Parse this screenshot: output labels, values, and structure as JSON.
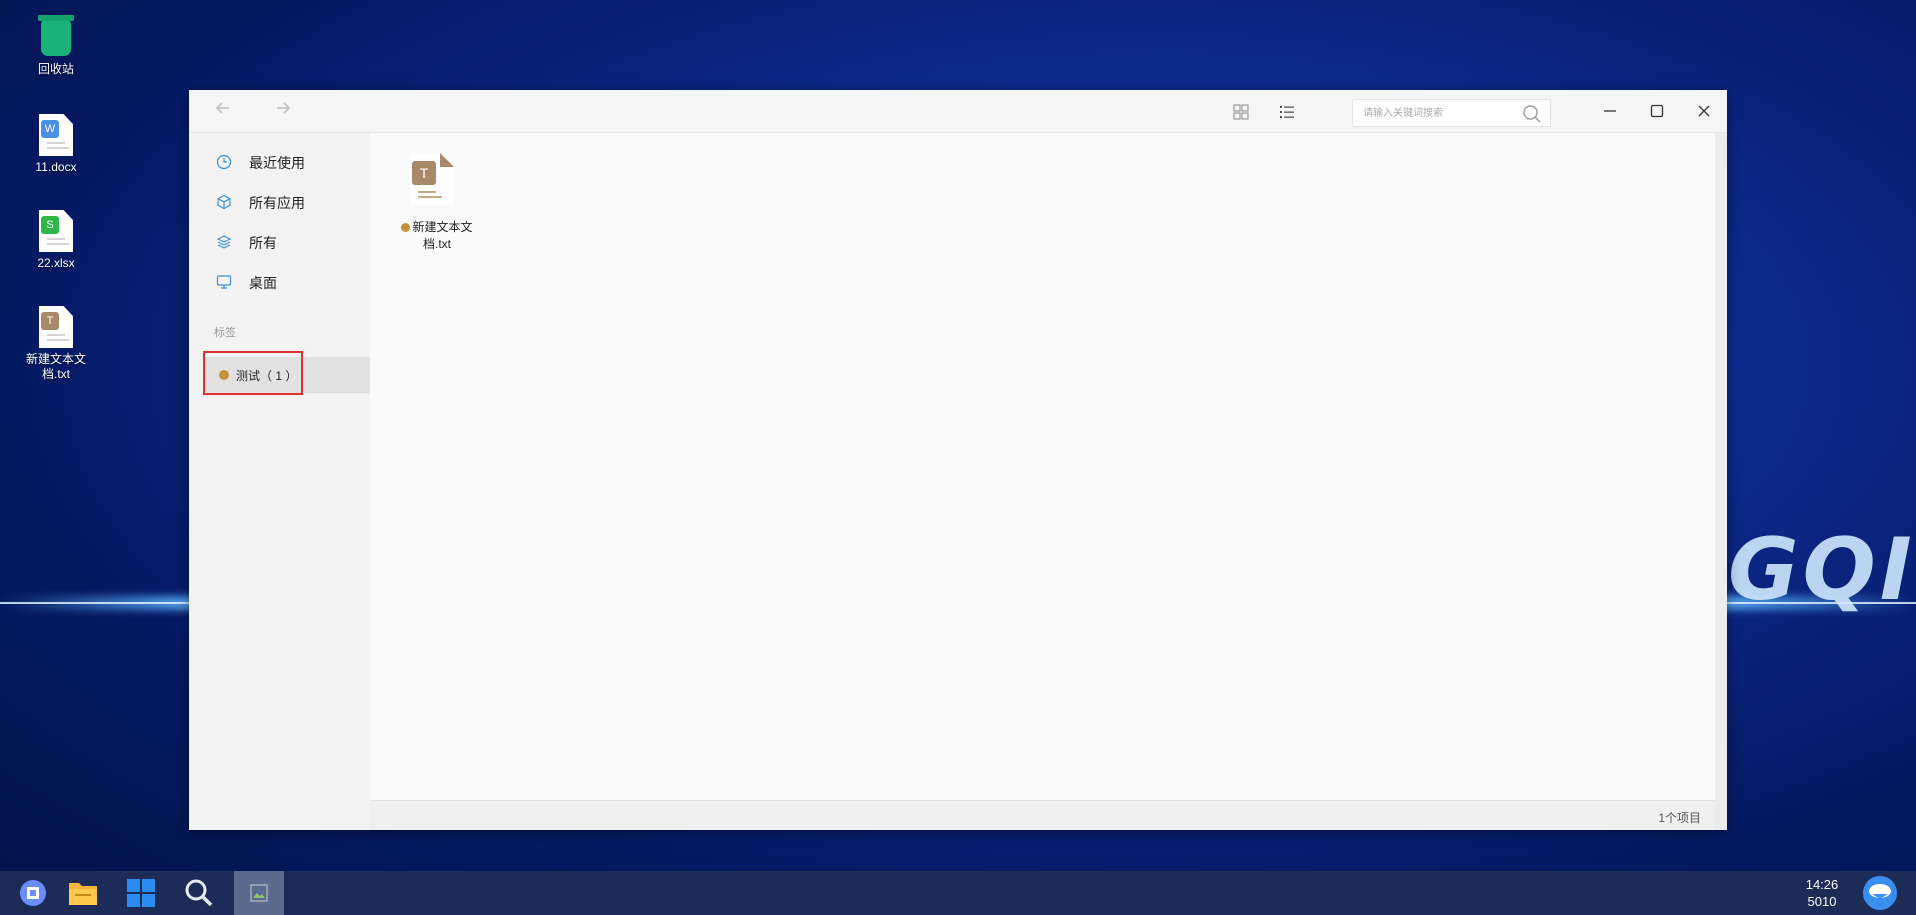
{
  "desktop": {
    "icons": [
      {
        "label": "回收站"
      },
      {
        "label": "11.docx",
        "badge": "W"
      },
      {
        "label": "22.xlsx",
        "badge": "S"
      },
      {
        "label": "新建文本文档.txt",
        "badge": "T"
      }
    ],
    "wallpaper_text": "GQI"
  },
  "window": {
    "search_placeholder": "请输入关键词搜索",
    "sidebar": {
      "items": [
        {
          "label": "最近使用",
          "icon": "clock-icon"
        },
        {
          "label": "所有应用",
          "icon": "cube-icon"
        },
        {
          "label": "所有",
          "icon": "layers-icon"
        },
        {
          "label": "桌面",
          "icon": "monitor-icon"
        }
      ],
      "section_title": "标签",
      "tag": {
        "label": "测试（ 1 ）",
        "color": "#c8903b"
      }
    },
    "files": [
      {
        "name": "新建文本文档.txt",
        "badge": "T",
        "tag_color": "#c8903b"
      }
    ],
    "status": "1个项目"
  },
  "taskbar": {
    "time": "14:26",
    "date": "5010"
  },
  "colors": {
    "highlight": "#e0302f",
    "tag": "#c8903b",
    "taskbar": "#1d2c57"
  }
}
